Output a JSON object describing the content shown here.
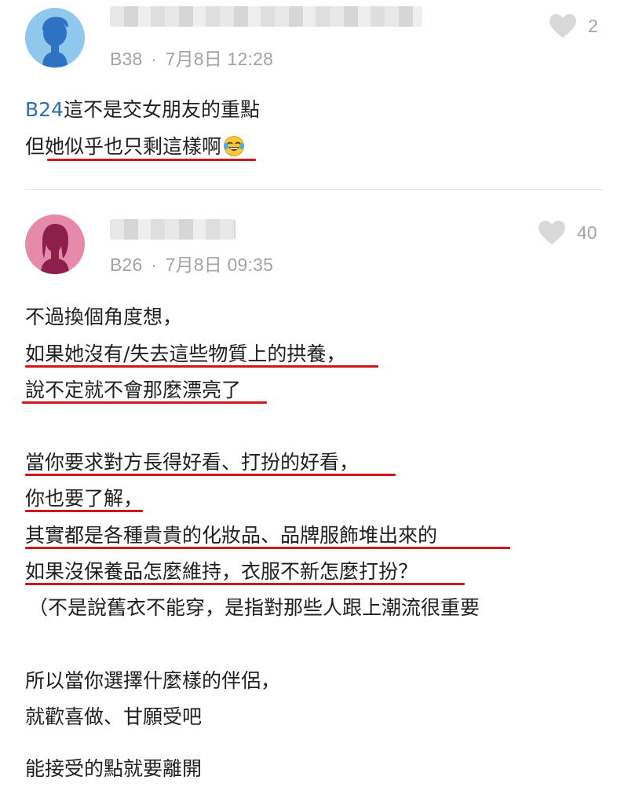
{
  "comments": [
    {
      "floor": "B38",
      "sep": "·",
      "time": "7月8日 12:28",
      "likes": "2",
      "mention": "B24",
      "lines": [
        "這不是交女朋友的重點",
        "但她似乎也只剩這樣啊"
      ]
    },
    {
      "floor": "B26",
      "sep": "·",
      "time": "7月8日 09:35",
      "likes": "40",
      "lines": [
        "不過換個角度想，",
        "如果她沒有/失去這些物質上的拱養，",
        "說不定就不會那麼漂亮了",
        "當你要求對方長得好看、打扮的好看，",
        "你也要了解，",
        "其實都是各種貴貴的化妝品、品牌服飾堆出來的",
        "如果沒保養品怎麼維持，衣服不新怎麼打扮？",
        "（不是說舊衣不能穿，是指對那些人跟上潮流很重要",
        "所以當你選擇什麼樣的伴侶，",
        "就歡喜做、甘願受吧",
        "能接受的點就要離開"
      ]
    }
  ],
  "colors": {
    "avatar_male_bg": "#8fc8ec",
    "avatar_male_fg": "#2f72c3",
    "avatar_female_bg": "#e58aa9",
    "avatar_female_fg": "#8c1f4c",
    "underline": "#d11818",
    "mention": "#2f6ea8"
  }
}
